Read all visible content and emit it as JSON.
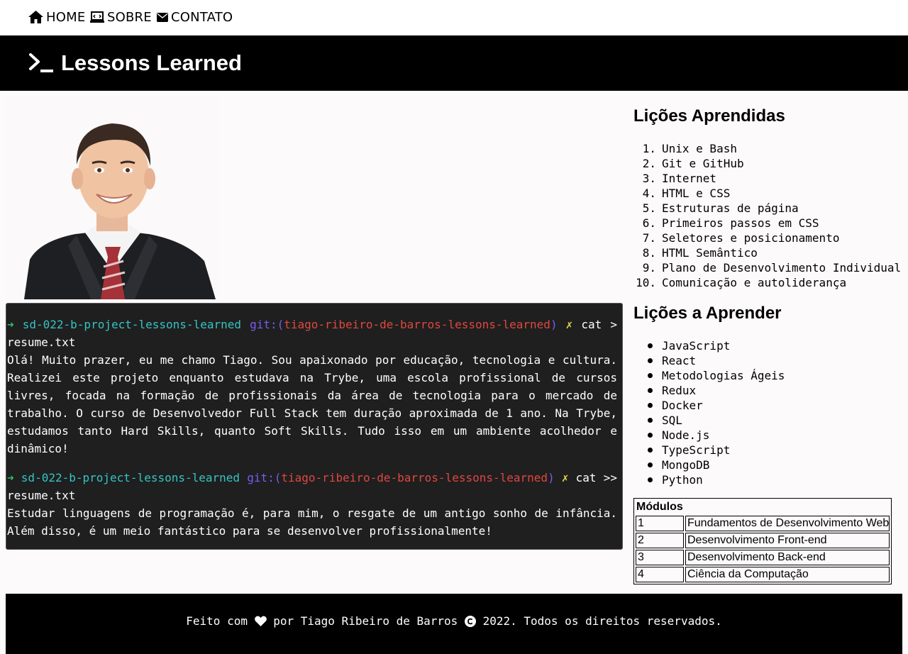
{
  "nav": {
    "items": [
      {
        "label": "HOME",
        "icon": "home-icon"
      },
      {
        "label": "SOBRE",
        "icon": "laptop-code-icon"
      },
      {
        "label": "CONTATO",
        "icon": "envelope-icon"
      }
    ]
  },
  "header": {
    "title": "Lessons Learned",
    "icon": "terminal-icon"
  },
  "terminal": {
    "prompt_arrow": "➜",
    "repo": "sd-022-b-project-lessons-learned",
    "git_prefix": "git:(",
    "branch": "tiago-ribeiro-de-barros-lessons-learned",
    "git_suffix": ")",
    "dirty_mark": "✗",
    "command1": "cat >",
    "file1": "resume.txt",
    "text1": "Olá! Muito prazer, eu me chamo Tiago. Sou apaixonado por educação, tecnologia e cultura. Realizei este projeto enquanto estudava na Trybe, uma escola profissional de cursos livres, focada na formação de profissionais da área de tecnologia para o mercado de trabalho. O curso de Desenvolvedor Full Stack tem duração aproximada de 1 ano. Na Trybe, estudamos tanto Hard Skills, quanto Soft Skills. Tudo isso em um ambiente acolhedor e dinâmico!",
    "command2": "cat >>",
    "file2": "resume.txt",
    "text2": "Estudar linguagens de programação é, para mim, o resgate de um antigo sonho de infância. Além disso, é um meio fantástico para se desenvolver profissionalmente!"
  },
  "learned": {
    "title": "Lições Aprendidas",
    "items": [
      "Unix e Bash",
      "Git e GitHub",
      "Internet",
      "HTML e CSS",
      "Estruturas de página",
      "Primeiros passos em CSS",
      "Seletores e posicionamento",
      "HTML Semântico",
      "Plano de Desenvolvimento Individual",
      "Comunicação e autoliderança"
    ]
  },
  "to_learn": {
    "title": "Lições a Aprender",
    "items": [
      "JavaScript",
      "React",
      "Metodologias Ágeis",
      "Redux",
      "Docker",
      "SQL",
      "Node.js",
      "TypeScript",
      "MongoDB",
      "Python"
    ]
  },
  "modules": {
    "caption": "Módulos",
    "rows": [
      {
        "num": "1",
        "name": "Fundamentos de Desenvolvimento Web"
      },
      {
        "num": "2",
        "name": "Desenvolvimento Front-end"
      },
      {
        "num": "3",
        "name": "Desenvolvimento Back-end"
      },
      {
        "num": "4",
        "name": "Ciência da Computação"
      }
    ]
  },
  "footer": {
    "prefix": "Feito com ",
    "middle": " por Tiago Ribeiro de Barros ",
    "suffix": " 2022. Todos os direitos reservados.",
    "heart_icon": "heart-icon",
    "copyright_icon": "copyright-icon"
  }
}
